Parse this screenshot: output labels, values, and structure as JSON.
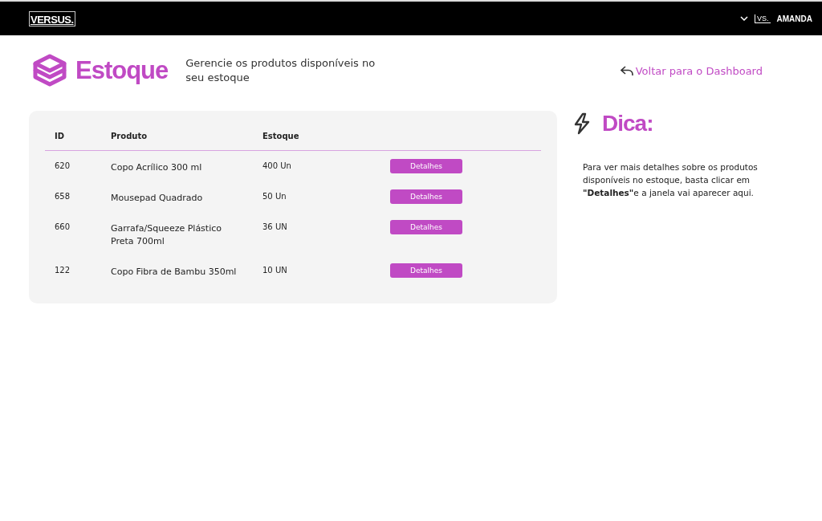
{
  "topbar": {
    "logo": "VERSUS.",
    "user_badge": "VS.",
    "user_name": "AMANDA"
  },
  "header": {
    "title": "Estoque",
    "subtitle": "Gerencie os produtos disponíveis no seu estoque",
    "back_link": "Voltar para o Dashboard"
  },
  "table": {
    "columns": [
      "ID",
      "Produto",
      "Estoque"
    ],
    "rows": [
      {
        "id": "620",
        "product": "Copo Acrílico 300 ml",
        "stock": "400 Un",
        "action": "Detalhes"
      },
      {
        "id": "658",
        "product": "Mousepad Quadrado",
        "stock": "50 Un",
        "action": "Detalhes"
      },
      {
        "id": "660",
        "product": "Garrafa/Squeeze Plástico Preta 700ml",
        "stock": "36 UN",
        "action": "Detalhes"
      },
      {
        "id": "122",
        "product": "Copo Fibra de Bambu 350ml",
        "stock": "10 UN",
        "action": "Detalhes"
      }
    ]
  },
  "tip": {
    "title": "Dica:",
    "text": "Para ver mais detalhes sobre os produtos disponíveis no estoque, basta clicar em **\"Detalhes\"**e a janela vai aparecer aqui."
  }
}
